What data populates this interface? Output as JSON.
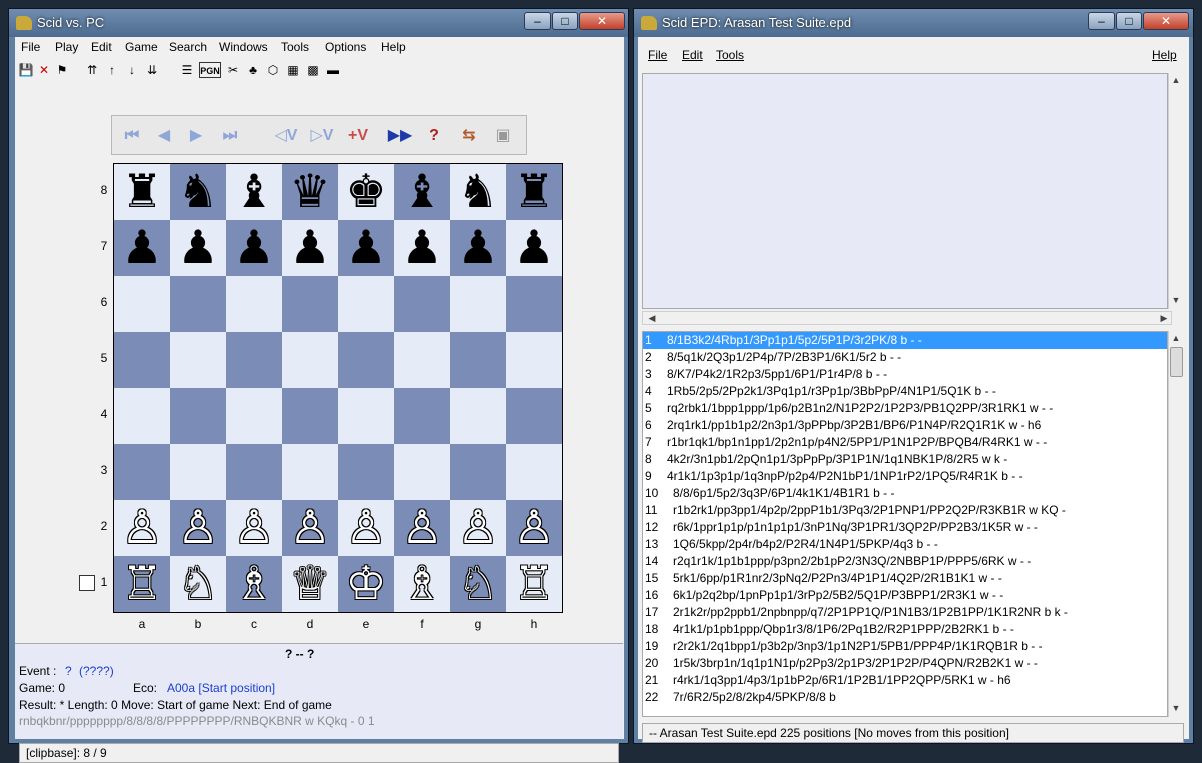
{
  "left_window": {
    "title": "Scid vs. PC",
    "menu": [
      "File",
      "Play",
      "Edit",
      "Game",
      "Search",
      "Windows",
      "Tools",
      "Options",
      "Help"
    ],
    "nav_buttons": [
      "⏮",
      "◀",
      "▶",
      "⏭",
      "◁V",
      "▷V",
      "+V",
      "▶▶",
      "?",
      "⇆",
      "▣"
    ],
    "ranks": [
      "8",
      "7",
      "6",
      "5",
      "4",
      "3",
      "2",
      "1"
    ],
    "files": [
      "a",
      "b",
      "c",
      "d",
      "e",
      "f",
      "g",
      "h"
    ],
    "board": [
      [
        "♜",
        "♞",
        "♝",
        "♛",
        "♚",
        "♝",
        "♞",
        "♜"
      ],
      [
        "♟",
        "♟",
        "♟",
        "♟",
        "♟",
        "♟",
        "♟",
        "♟"
      ],
      [
        "",
        "",
        "",
        "",
        "",
        "",
        "",
        ""
      ],
      [
        "",
        "",
        "",
        "",
        "",
        "",
        "",
        ""
      ],
      [
        "",
        "",
        "",
        "",
        "",
        "",
        "",
        ""
      ],
      [
        "",
        "",
        "",
        "",
        "",
        "",
        "",
        ""
      ],
      [
        "♙",
        "♙",
        "♙",
        "♙",
        "♙",
        "♙",
        "♙",
        "♙"
      ],
      [
        "♖",
        "♘",
        "♗",
        "♕",
        "♔",
        "♗",
        "♘",
        "♖"
      ]
    ],
    "info": {
      "players": "?   --   ?",
      "event_label": "Event :",
      "event_value": "?",
      "event_date": "(????)",
      "game": "Game: 0",
      "eco_label": "Eco:",
      "eco_value": "A00a [Start position]",
      "result": "Result: *   Length: 0   Move:   Start of game   Next:   End of game",
      "fen": "rnbqkbnr/pppppppp/8/8/8/8/PPPPPPPP/RNBQKBNR w KQkq - 0 1"
    },
    "status": "[clipbase]:   8 / 9"
  },
  "right_window": {
    "title": "Scid EPD: Arasan Test Suite.epd",
    "menu": [
      "File",
      "Edit",
      "Tools"
    ],
    "help": "Help",
    "rows": [
      {
        "n": "1",
        "fen": "8/1B3k2/4Rbp1/3Pp1p1/5p2/5P1P/3r2PK/8 b - -"
      },
      {
        "n": "2",
        "fen": "8/5q1k/2Q3p1/2P4p/7P/2B3P1/6K1/5r2 b - -"
      },
      {
        "n": "3",
        "fen": "8/K7/P4k2/1R2p3/5pp1/6P1/P1r4P/8 b - -"
      },
      {
        "n": "4",
        "fen": "1Rb5/2p5/2Pp2k1/3Pq1p1/r3Pp1p/3BbPpP/4N1P1/5Q1K b - -"
      },
      {
        "n": "5",
        "fen": "rq2rbk1/1bpp1ppp/1p6/p2B1n2/N1P2P2/1P2P3/PB1Q2PP/3R1RK1 w - -"
      },
      {
        "n": "6",
        "fen": "2rq1rk1/pp1b1p2/2n3p1/3pPPbp/3P2B1/BP6/P1N4P/R2Q1R1K w - h6"
      },
      {
        "n": "7",
        "fen": "r1br1qk1/bp1n1pp1/2p2n1p/p4N2/5PP1/P1N1P2P/BPQB4/R4RK1 w - -"
      },
      {
        "n": "8",
        "fen": "4k2r/3n1pb1/2pQn1p1/3pPpPp/3P1P1N/1q1NBK1P/8/2R5 w k -"
      },
      {
        "n": "9",
        "fen": "4r1k1/1p3p1p/1q3npP/p2p4/P2N1bP1/1NP1rP2/1PQ5/R4R1K b - -"
      },
      {
        "n": "10",
        "fen": "8/8/6p1/5p2/3q3P/6P1/4k1K1/4B1R1 b - -"
      },
      {
        "n": "11",
        "fen": "r1b2rk1/pp3pp1/4p2p/2ppP1b1/3Pq3/2P1PNP1/PP2Q2P/R3KB1R w KQ -"
      },
      {
        "n": "12",
        "fen": "r6k/1ppr1p1p/p1n1p1p1/3nP1Nq/3P1PR1/3QP2P/PP2B3/1K5R w - -"
      },
      {
        "n": "13",
        "fen": "1Q6/5kpp/2p4r/b4p2/P2R4/1N4P1/5PKP/4q3 b - -"
      },
      {
        "n": "14",
        "fen": "r2q1r1k/1p1b1ppp/p3pn2/2b1pP2/3N3Q/2NBBP1P/PPP5/6RK w - -"
      },
      {
        "n": "15",
        "fen": "5rk1/6pp/p1R1nr2/3pNq2/P2Pn3/4P1P1/4Q2P/2R1B1K1 w - -"
      },
      {
        "n": "16",
        "fen": "6k1/p2q2bp/1pnPp1p1/3rPp2/5B2/5Q1P/P3BPP1/2R3K1 w - -"
      },
      {
        "n": "17",
        "fen": "2r1k2r/pp2ppb1/2npbnpp/q7/2P1PP1Q/P1N1B3/1P2B1PP/1K1R2NR b k -"
      },
      {
        "n": "18",
        "fen": "4r1k1/p1pb1ppp/Qbp1r3/8/1P6/2Pq1B2/R2P1PPP/2B2RK1 b - -"
      },
      {
        "n": "19",
        "fen": "r2r2k1/2q1bpp1/p3b2p/3np3/1p1N2P1/5PB1/PPP4P/1K1RQB1R b - -"
      },
      {
        "n": "20",
        "fen": "1r5k/3brp1n/1q1p1N1p/p2Pp3/2p1P3/2P1P2P/P4QPN/R2B2K1 w - -"
      },
      {
        "n": "21",
        "fen": "r4rk1/1q3pp1/4p3/1p1bP2p/6R1/1P2B1/1PP2QPP/5RK1 w - h6"
      },
      {
        "n": "22",
        "fen": "7r/6R2/5p2/8/2kp4/5PKP/8/8 b"
      }
    ],
    "status": "--  Arasan Test Suite.epd  225 positions  [No moves from this position]"
  }
}
